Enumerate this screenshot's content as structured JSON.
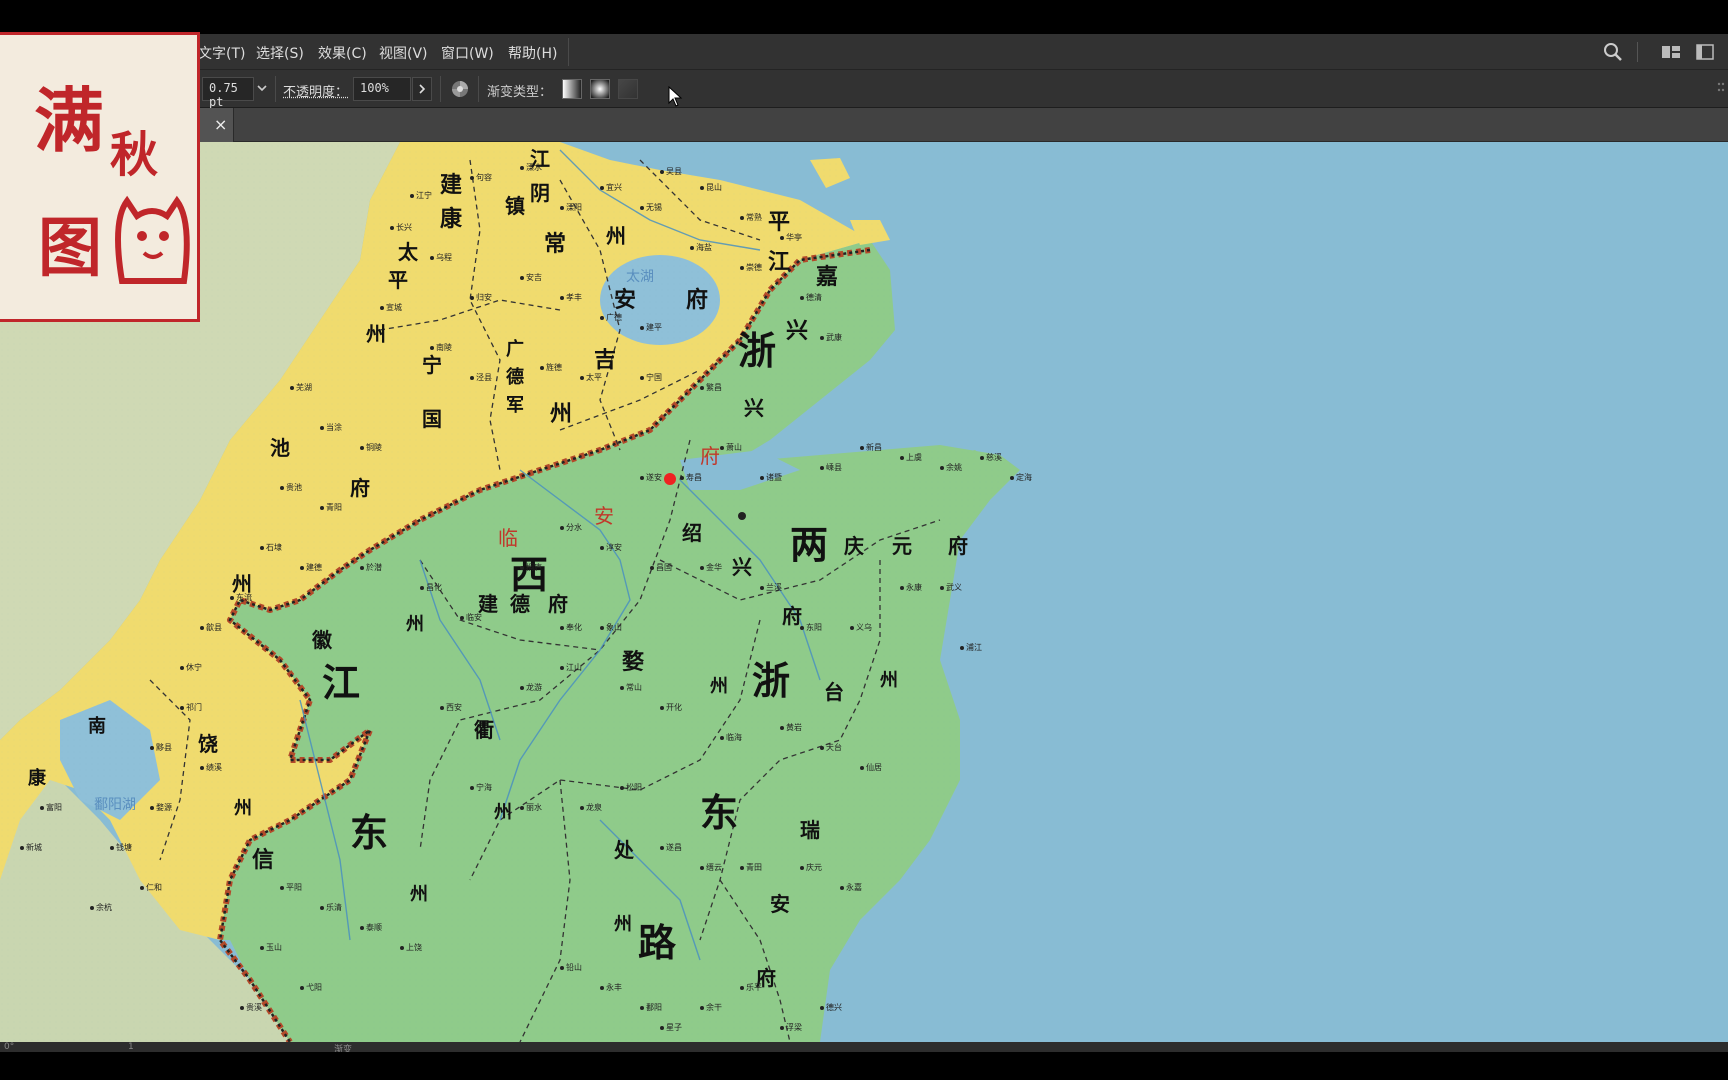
{
  "menus": [
    "文字(T)",
    "选择(S)",
    "效果(C)",
    "视图(V)",
    "窗口(W)",
    "帮助(H)"
  ],
  "control_bar": {
    "stroke_value": "0.75 pt",
    "opacity_label": "不透明度：",
    "opacity_value": "100%",
    "gradient_type_label": "渐变类型："
  },
  "tab": {
    "close_glyph": "×"
  },
  "seal_text": [
    "满",
    "秋",
    "图"
  ],
  "map": {
    "region_labels": [
      "浙",
      "西",
      "两",
      "浙",
      "东",
      "路",
      "江",
      "东"
    ],
    "prefecture_labels": {
      "jiankang": [
        "建",
        "康",
        "府"
      ],
      "zhenjiang": [
        "镇",
        "江",
        "府"
      ],
      "changzhou": [
        "常",
        "州"
      ],
      "pingjiang": [
        "平",
        "江",
        "府"
      ],
      "jiaxing": [
        "嘉",
        "兴"
      ],
      "anji": [
        "安",
        "吉",
        "州"
      ],
      "guangde": [
        "广",
        "德",
        "军"
      ],
      "ningguo": [
        "宁",
        "国",
        "府"
      ],
      "taiping": [
        "太",
        "平",
        "州"
      ],
      "chizhou": [
        "池",
        "州"
      ],
      "huizhou": [
        "徽",
        "州"
      ],
      "jiande": [
        "建",
        "德",
        "府"
      ],
      "linan": [
        "临",
        "安",
        "府"
      ],
      "shaoxing": [
        "绍",
        "兴",
        "府"
      ],
      "qingyuan": [
        "庆",
        "元",
        "府"
      ],
      "wuzhou": [
        "婺",
        "州"
      ],
      "quzhou": [
        "衢",
        "州"
      ],
      "taizhou": [
        "台",
        "州"
      ],
      "chuzhou": [
        "处",
        "州"
      ],
      "ruian": [
        "瑞",
        "安",
        "府"
      ],
      "xinzhou": [
        "信",
        "州"
      ],
      "raozhou": [
        "饶",
        "州"
      ],
      "nankang": [
        "南",
        "康"
      ],
      "jiangyin": [
        "江",
        "阴"
      ]
    },
    "lakes": [
      "太湖",
      "鄱阳湖"
    ],
    "towns": [
      "江宁",
      "句容",
      "溧水",
      "溧阳",
      "宜兴",
      "无锡",
      "吴县",
      "昆山",
      "常熟",
      "华亭",
      "海盐",
      "崇德",
      "德清",
      "武康",
      "长兴",
      "乌程",
      "归安",
      "安吉",
      "孝丰",
      "广德",
      "建平",
      "宣城",
      "南陵",
      "泾县",
      "旌德",
      "太平",
      "宁国",
      "繁昌",
      "芜湖",
      "当涂",
      "铜陵",
      "贵池",
      "青阳",
      "石埭",
      "建德",
      "东流",
      "歙县",
      "休宁",
      "祁门",
      "黟县",
      "绩溪",
      "婺源",
      "钱塘",
      "仁和",
      "余杭",
      "富阳",
      "新城",
      "於潜",
      "昌化",
      "临安",
      "桐庐",
      "分水",
      "淳安",
      "遂安",
      "寿昌",
      "萧山",
      "诸暨",
      "嵊县",
      "新昌",
      "上虞",
      "余姚",
      "慈溪",
      "定海",
      "奉化",
      "象山",
      "昌国",
      "金华",
      "兰溪",
      "东阳",
      "义乌",
      "永康",
      "武义",
      "浦江",
      "西安",
      "龙游",
      "江山",
      "常山",
      "开化",
      "临海",
      "黄岩",
      "天台",
      "仙居",
      "宁海",
      "丽水",
      "龙泉",
      "松阳",
      "遂昌",
      "缙云",
      "青田",
      "庆元",
      "永嘉",
      "平阳",
      "乐清",
      "泰顺",
      "上饶",
      "玉山",
      "弋阳",
      "贵溪",
      "铅山",
      "永丰",
      "鄱阳",
      "余干",
      "乐平",
      "浮梁",
      "德兴",
      "安仁",
      "都昌",
      "星子",
      "建昌"
    ]
  },
  "status": {
    "zoom": "0°",
    "page": "1",
    "mode": "渐变"
  }
}
